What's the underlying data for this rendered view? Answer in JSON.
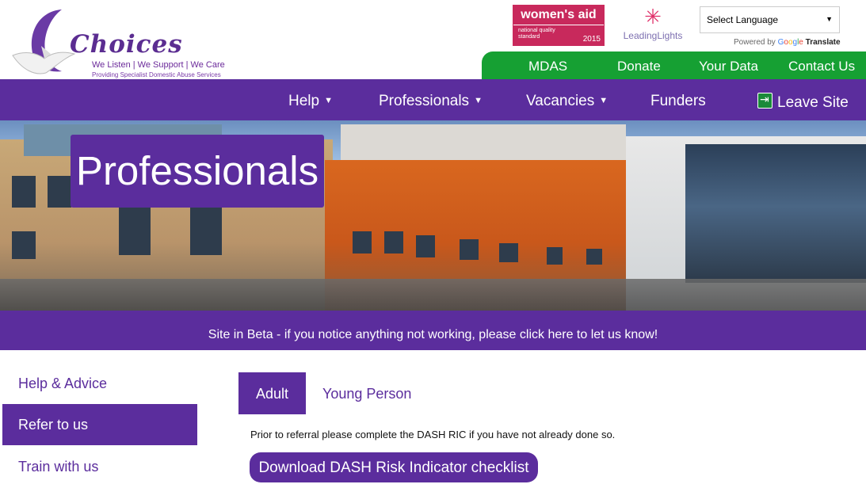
{
  "brand": {
    "logo_word": "Choices",
    "tagline": "We Listen | We Support | We Care",
    "subtitle": "Providing Specialist Domestic Abuse Services"
  },
  "badges": {
    "womens_aid_title": "women's aid",
    "womens_aid_small": "national quality standard",
    "womens_aid_year": "2015",
    "leading_lights": "LeadingLights"
  },
  "language": {
    "select_label": "Select Language",
    "powered_prefix": "Powered by",
    "google": "Google",
    "translate": "Translate"
  },
  "top_links": [
    "MDAS",
    "Donate",
    "Your Data",
    "Contact Us"
  ],
  "nav": {
    "items": [
      {
        "label": "Help",
        "dropdown": true
      },
      {
        "label": "Professionals",
        "dropdown": true
      },
      {
        "label": "Vacancies",
        "dropdown": true
      },
      {
        "label": "Funders",
        "dropdown": false
      }
    ],
    "leave_site": "Leave Site"
  },
  "hero": {
    "title": "Professionals"
  },
  "beta_notice": "Site in Beta - if you notice anything not working, please click here to let us know!",
  "sidebar": {
    "items": [
      {
        "label": "Help & Advice"
      },
      {
        "label": "Refer to us",
        "active": true
      },
      {
        "label": "Train with us"
      }
    ]
  },
  "tabs": [
    {
      "label": "Adult",
      "active": true
    },
    {
      "label": "Young Person",
      "active": false
    }
  ],
  "content": {
    "prior_text": "Prior to referral please complete the DASH RIC if you have not already done so.",
    "download_button": "Download DASH Risk Indicator checklist"
  },
  "colors": {
    "brand_purple": "#5b2d9d",
    "green_bar": "#16a033",
    "womens_aid_pink": "#c8295c"
  }
}
